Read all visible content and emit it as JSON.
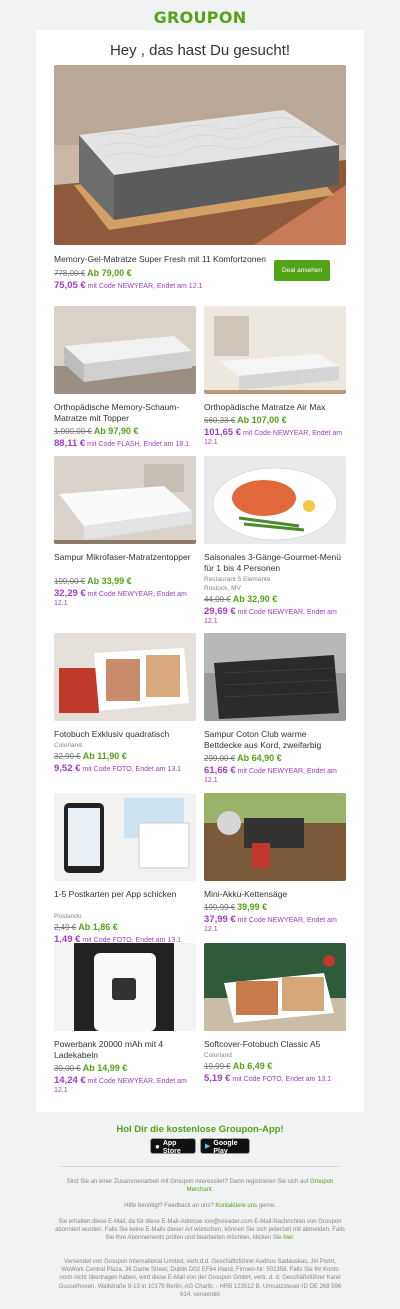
{
  "logo": "GROUPON",
  "greeting": "Hey , das hast Du gesucht!",
  "featured": {
    "title": "Memory-Gel-Matratze Super Fresh mit 11 Komfortzonen",
    "old_price": "778,00 €",
    "new_price": "Ab 79,00 €",
    "promo_price": "75,05 €",
    "promo_text": "mit Code NEWYEAR, Endet am 12.1",
    "button": "Deal ansehen"
  },
  "deals": [
    {
      "title": "Orthopädische Memory-Schaum-Matratze mit Topper",
      "vendor": "",
      "vendor2": "",
      "old_price": "1.000,00 €",
      "new_price": "Ab 97,90 €",
      "promo_price": "88,11 €",
      "promo_text": "mit Code FLASH, Endet am 18.1"
    },
    {
      "title": "Orthopädische Matratze Air Max",
      "vendor": "",
      "vendor2": "",
      "old_price": "660,33 €",
      "new_price": "Ab 107,00 €",
      "promo_price": "101,65 €",
      "promo_text": "mit Code NEWYEAR, Endet am 12.1"
    },
    {
      "title": "Sampur Mikrofaser-Matratzentopper",
      "vendor": "",
      "vendor2": "",
      "old_price": "199,00 €",
      "new_price": "Ab 33,99 €",
      "promo_price": "32,29 €",
      "promo_text": "mit Code NEWYEAR, Endet am 12.1"
    },
    {
      "title": "Saisonales 3-Gänge-Gourmet-Menü für 1 bis 4 Personen",
      "vendor": "Restaurant 5 Elemente",
      "vendor2": "Rostock, MV",
      "old_price": "44,00 €",
      "new_price": "Ab 32,90 €",
      "promo_price": "29,69 €",
      "promo_text": "mit Code NEWYEAR, Endet am 12.1"
    },
    {
      "title": "Fotobuch Exklusiv quadratisch",
      "vendor": "Colorland",
      "vendor2": "",
      "old_price": "32,99 €",
      "new_price": "Ab 11,90 €",
      "promo_price": "9,52 €",
      "promo_text": "mit Code FOTO, Endet am 13.1"
    },
    {
      "title": "Sampur Coton Club warme Bettdecke aus Kord, zweifarbig",
      "vendor": "",
      "vendor2": "",
      "old_price": "299,00 €",
      "new_price": "Ab 64,90 €",
      "promo_price": "61,66 €",
      "promo_text": "mit Code NEWYEAR, Endet am 12.1"
    },
    {
      "title": "1-5 Postkarten per App schicken",
      "vendor": "Postando",
      "vendor2": "",
      "old_price": "2,49 €",
      "new_price": "Ab 1,86 €",
      "promo_price": "1,49 €",
      "promo_text": "mit Code FOTO, Endet am 13.1"
    },
    {
      "title": "Mini-Akku-Kettensäge",
      "vendor": "",
      "vendor2": "",
      "old_price": "199,99 €",
      "new_price": "39,99 €",
      "promo_price": "37,99 €",
      "promo_text": "mit Code NEWYEAR, Endet am 12.1"
    },
    {
      "title": "Powerbank 20000 mAh mit 4 Ladekabeln",
      "vendor": "",
      "vendor2": "",
      "old_price": "39,00 €",
      "new_price": "Ab 14,99 €",
      "promo_price": "14,24 €",
      "promo_text": "mit Code NEWYEAR, Endet am 12.1"
    },
    {
      "title": "Softcover-Fotobuch Classic A5",
      "vendor": "Colorland",
      "vendor2": "",
      "old_price": "19,99 €",
      "new_price": "Ab 6,49 €",
      "promo_price": "5,19 €",
      "promo_text": "mit Code FOTO, Endet am 13.1"
    }
  ],
  "app": {
    "heading": "Hol Dir die kostenlose Groupon-App!",
    "appstore_small": "Download on the",
    "appstore_big": "App Store",
    "googleplay_small": "GET IT ON",
    "googleplay_big": "Google Play"
  },
  "footer": {
    "merchant_text": "Sind Sie an einer Zusammenarbeit mit Groupon interessiert? Dann registrieren Sie sich auf",
    "merchant_link": "Groupon Merchant",
    "help_pre": "Hilfe benötigt? Feedback an uns?",
    "help_link": "Kontaktiere uns",
    "help_post": "gerne.",
    "unsub_text": "Sie erhalten diese E-Mail, da für diese E-Mail-Adresse xxx@ureader.com E-Mail-Nachrichten von Groupon abonniert wurden. Falls Sie keine E-Mails dieser Art wünschen, können Sie sich jederzeit mit abmelden. Falls Sie Ihre Abonnements prüfen und bearbeiten möchten, klicken Sie",
    "unsub_link": "hier",
    "legal": "Versendet von Groupon International Limited, vertr.d.d. Geschäftsführer Audrius Sadauskas, Jiri Ponrt, WeWork Central Plaza, 36 Dame Street, Dublin D02 EF64 Irland, Firmen-Nr: 501358. Falls Sie Ihr Konto noch nicht übertragen haben, wird diese E-Mail von der Groupon GmbH, vertr. d. d. Geschäftsführer Karel Gusserhoven, Wallstraße 9-13 in 10179 Berlin, AG Charlb. - HRB 123512 B, Umsatzsteuer-ID DE 268 596 614, versendet"
  },
  "colors": {
    "brand": "#53a318",
    "promo": "#a13ec4"
  }
}
